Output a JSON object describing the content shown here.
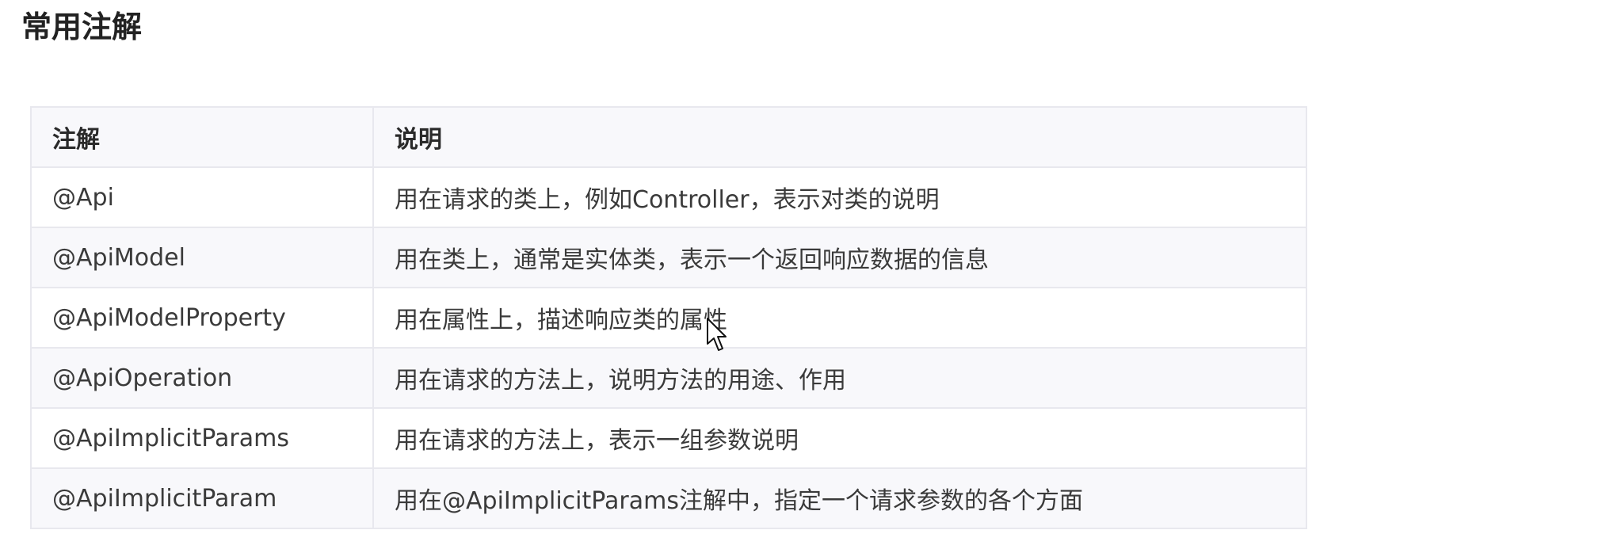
{
  "page": {
    "title": "常用注解"
  },
  "table": {
    "headers": [
      "注解",
      "说明"
    ],
    "rows": [
      [
        "@Api",
        "用在请求的类上，例如Controller，表示对类的说明"
      ],
      [
        "@ApiModel",
        "用在类上，通常是实体类，表示一个返回响应数据的信息"
      ],
      [
        "@ApiModelProperty",
        "用在属性上，描述响应类的属性"
      ],
      [
        "@ApiOperation",
        "用在请求的方法上，说明方法的用途、作用"
      ],
      [
        "@ApiImplicitParams",
        "用在请求的方法上，表示一组参数说明"
      ],
      [
        "@ApiImplicitParam",
        "用在@ApiImplicitParams注解中，指定一个请求参数的各个方面"
      ]
    ]
  },
  "icons": {
    "cursor": "mouse-pointer-icon"
  }
}
